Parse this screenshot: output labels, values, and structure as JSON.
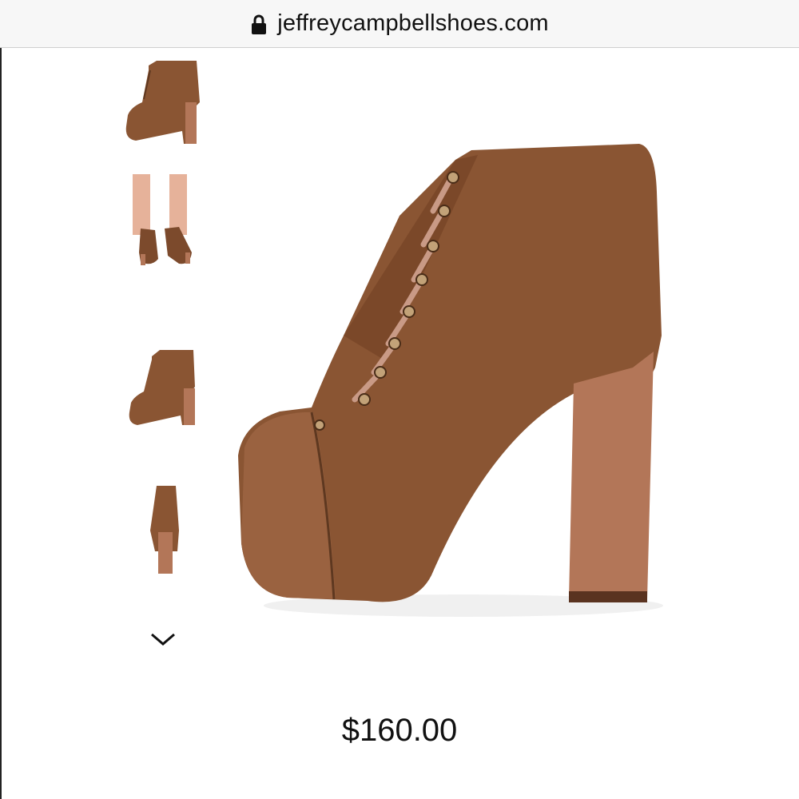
{
  "browser": {
    "url": "jeffreycampbellshoes.com"
  },
  "gallery": {
    "thumbnails": [
      {
        "view": "side-view"
      },
      {
        "view": "worn-front-view"
      },
      {
        "view": "angled-side-view"
      },
      {
        "view": "back-view"
      }
    ],
    "more_icon": "chevron-down-icon"
  },
  "product": {
    "price": "$160.00",
    "color": "#8a5533",
    "heel_color": "#b37658"
  }
}
